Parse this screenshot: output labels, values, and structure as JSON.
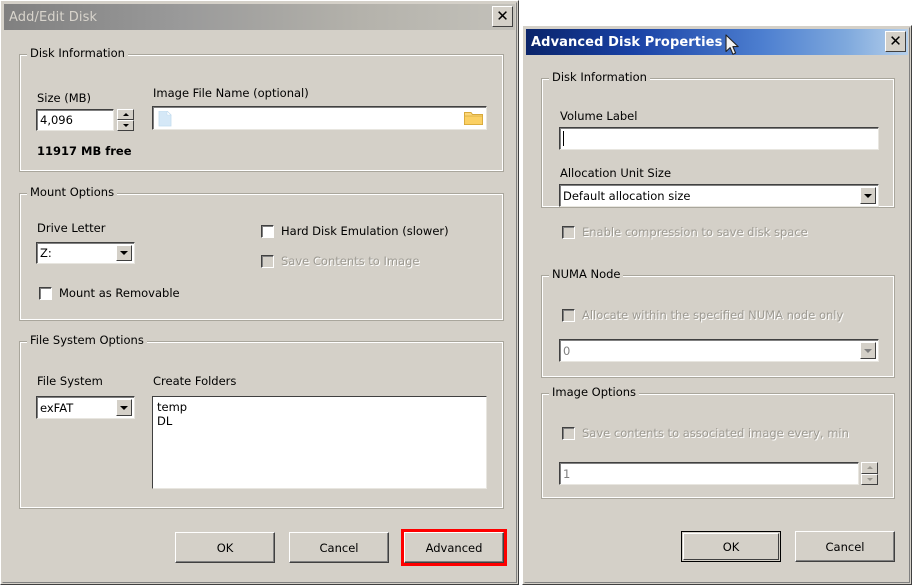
{
  "left_dialog": {
    "title": "Add/Edit Disk",
    "close_label": "✕",
    "groups": {
      "disk_information": {
        "title": "Disk Information",
        "size_label": "Size (MB)",
        "size_value": "4,096",
        "free_space": "11917 MB free",
        "image_file_label": "Image File Name (optional)",
        "image_file_value": "",
        "image_file_placeholder": "",
        "document_icon": "document-icon",
        "browse_icon": "folder-open-icon"
      },
      "mount_options": {
        "title": "Mount Options",
        "drive_letter_label": "Drive Letter",
        "drive_letter_value": "Z:",
        "mount_removable_label": "Mount as Removable",
        "mount_removable_checked": false,
        "hard_disk_emulation_label": "Hard Disk Emulation (slower)",
        "hard_disk_emulation_checked": false,
        "save_contents_label": "Save Contents to Image",
        "save_contents_checked": false,
        "save_contents_disabled": true
      },
      "file_system_options": {
        "title": "File System Options",
        "file_system_label": "File System",
        "file_system_value": "exFAT",
        "create_folders_label": "Create Folders",
        "create_folders_lines": [
          "temp",
          "DL"
        ]
      }
    },
    "buttons": {
      "ok": "OK",
      "cancel": "Cancel",
      "advanced": "Advanced"
    },
    "highlight_color": "#fe0000"
  },
  "right_dialog": {
    "title": "Advanced Disk Properties",
    "close_label": "✕",
    "cursor_icon": "mouse-pointer-icon",
    "titlebar_gradient_start": "#0a246a",
    "titlebar_gradient_end": "#b6d0ec",
    "groups": {
      "disk_information": {
        "title": "Disk Information",
        "volume_label_label": "Volume Label",
        "volume_label_value": "",
        "allocation_unit_label": "Allocation Unit Size",
        "allocation_unit_value": "Default allocation size",
        "enable_compression_label": "Enable compression to save disk space",
        "enable_compression_checked": false,
        "enable_compression_disabled": true
      },
      "numa_node": {
        "title": "NUMA Node",
        "allocate_numa_label": "Allocate within the specified NUMA node only",
        "allocate_numa_checked": false,
        "allocate_numa_disabled": true,
        "numa_node_value": "0"
      },
      "image_options": {
        "title": "Image Options",
        "save_contents_label": "Save contents to associated image every, min",
        "save_contents_checked": false,
        "save_contents_disabled": true,
        "interval_value": "1"
      }
    },
    "buttons": {
      "ok": "OK",
      "cancel": "Cancel"
    }
  }
}
